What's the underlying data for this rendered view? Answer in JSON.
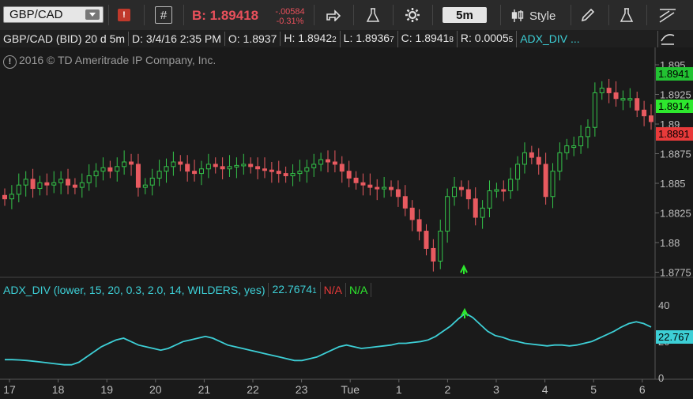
{
  "toolbar": {
    "symbol": "GBP/CAD",
    "bid_label": "B: 1.89418",
    "change_abs": "-.00584",
    "change_pct": "-0.31%",
    "timeframe": "5m",
    "style_label": "Style",
    "icons": [
      "flag-icon",
      "hash-icon",
      "share-icon",
      "flask-icon",
      "gear-icon",
      "candles-icon",
      "pencil-icon",
      "flask-icon",
      "lines-icon"
    ]
  },
  "infobar": {
    "symbol_desc": "GBP/CAD (BID) 20 d 5m",
    "date": "D: 3/4/16 2:35 PM",
    "open": "O: 1.8937",
    "high": "H: 1.8942",
    "high_small": "2",
    "low": "L: 1.8936",
    "low_small": "7",
    "close": "C: 1.8941",
    "close_small": "8",
    "range": "R: 0.0005",
    "range_small": "5",
    "study": "ADX_DIV ..."
  },
  "copyright": "2016 © TD Ameritrade IP Company, Inc.",
  "price_axis": {
    "ticks": [
      "1.895",
      "1.8925",
      "1.89",
      "1.8875",
      "1.885",
      "1.8825",
      "1.88",
      "1.8775"
    ],
    "flags": [
      {
        "label": "1.8941",
        "color": "#22c232"
      },
      {
        "label": "1.8914",
        "color": "#2ee82e"
      },
      {
        "label": "1.8891",
        "color": "#e83a3a"
      }
    ]
  },
  "lower_panel": {
    "study_desc": "ADX_DIV (lower, 15, 20, 0.3, 2.0, 14, WILDERS, yes)",
    "value": "22.7674",
    "value_small": "1",
    "na1": "N/A",
    "na2": "N/A",
    "ticks": [
      "40",
      "20",
      "0"
    ],
    "flag": "22.767"
  },
  "x_axis": {
    "labels": [
      "17",
      "18",
      "19",
      "20",
      "21",
      "22",
      "23",
      "Tue",
      "1",
      "2",
      "3",
      "4",
      "5",
      "6"
    ]
  },
  "chart_data": {
    "type": "candlestick",
    "series": [
      {
        "name": "GBP/CAD (BID)",
        "values": [
          1.8838,
          1.8842,
          1.885,
          1.8855,
          1.8847,
          1.8852,
          1.885,
          1.8852,
          1.8855,
          1.885,
          1.8848,
          1.8852,
          1.8858,
          1.8862,
          1.8865,
          1.8862,
          1.8866,
          1.887,
          1.8868,
          1.8848,
          1.885,
          1.8856,
          1.8862,
          1.8866,
          1.887,
          1.8868,
          1.8862,
          1.886,
          1.8864,
          1.8868,
          1.8866,
          1.8864,
          1.8866,
          1.8867,
          1.8868,
          1.8866,
          1.8864,
          1.8863,
          1.8862,
          1.886,
          1.8858,
          1.886,
          1.8862,
          1.8865,
          1.8868,
          1.8872,
          1.887,
          1.8868,
          1.8862,
          1.8856,
          1.8852,
          1.885,
          1.8848,
          1.8847,
          1.8848,
          1.8846,
          1.884,
          1.883,
          1.882,
          1.881,
          1.8795,
          1.8784,
          1.881,
          1.884,
          1.8848,
          1.8846,
          1.8838,
          1.8822,
          1.883,
          1.8845,
          1.8846,
          1.8845,
          1.8855,
          1.8868,
          1.8878,
          1.8874,
          1.8868,
          1.884,
          1.8862,
          1.8878,
          1.8884,
          1.8884,
          1.8892,
          1.89,
          1.893,
          1.8934,
          1.893,
          1.8925,
          1.8925,
          1.8925,
          1.8915,
          1.891,
          1.8905
        ]
      }
    ],
    "ylim": [
      1.8772,
      1.8968
    ]
  },
  "adx_data": {
    "values": [
      10.5,
      10.5,
      10.3,
      10.0,
      9.5,
      9.0,
      8.5,
      8.0,
      7.5,
      7.5,
      9,
      12,
      15,
      18,
      20,
      22,
      23,
      21,
      19,
      18,
      17,
      16,
      17,
      19,
      21,
      22,
      23,
      24,
      23,
      21,
      19,
      18,
      17,
      16,
      15,
      14,
      13,
      12,
      11,
      10,
      10,
      11,
      12,
      14,
      16,
      18,
      19,
      18,
      17,
      17.5,
      18,
      18.5,
      19,
      20,
      20,
      20.5,
      21,
      22,
      24,
      27,
      30,
      34,
      37.5,
      35,
      31,
      27,
      24.5,
      23.5,
      22,
      21,
      20,
      19.5,
      19,
      18.5,
      19,
      19,
      18.5,
      19,
      20,
      21,
      23,
      25,
      27,
      29.5,
      31.5,
      32.5,
      31.5,
      29.5
    ],
    "ylim": [
      0,
      46
    ]
  }
}
